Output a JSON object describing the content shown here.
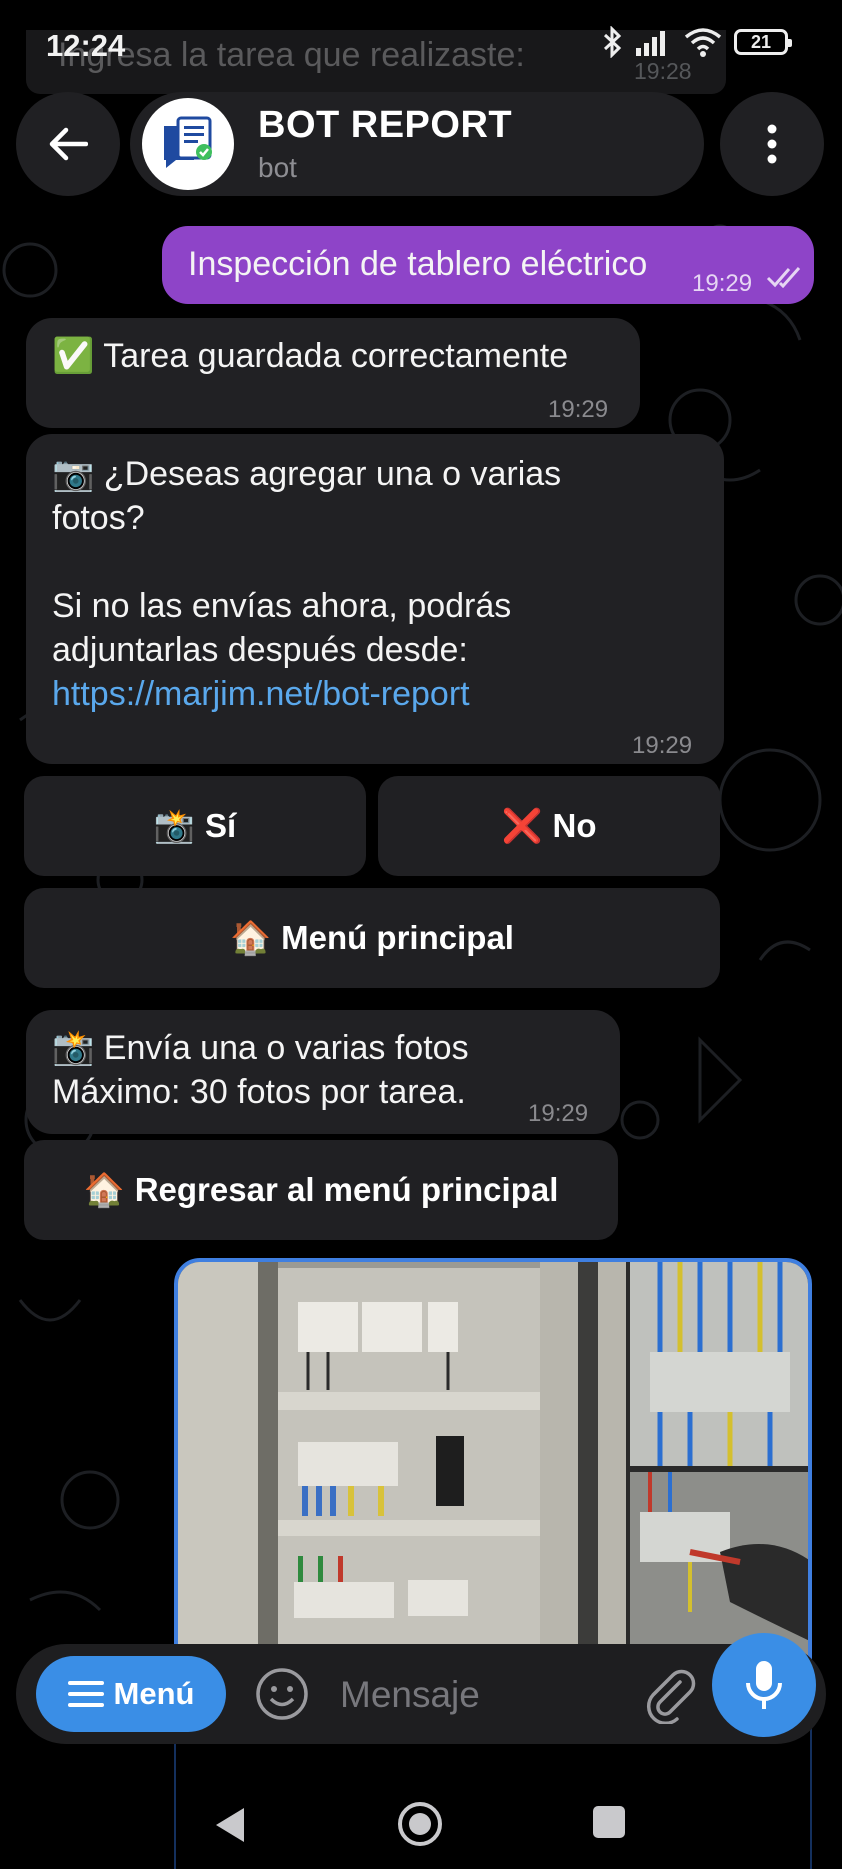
{
  "status_bar": {
    "time": "12:24",
    "battery": "21"
  },
  "ghost_message": {
    "text": "Ingresa la tarea que realizaste:",
    "time": "19:28"
  },
  "header": {
    "title": "BOT REPORT",
    "subtitle": "bot",
    "avatar_icon": "report-document-icon",
    "back_icon": "arrow-left-icon",
    "menu_icon": "more-vert-icon"
  },
  "messages": {
    "user_task": {
      "text": "Inspección de tablero eléctrico",
      "time": "19:29",
      "status_icon": "double-check-icon"
    },
    "saved": {
      "emoji": "✅",
      "text": "Tarea guardada correctamente",
      "time": "19:29"
    },
    "ask_photos": {
      "emoji": "📷",
      "line1": "¿Deseas agregar una o varias fotos?",
      "line2": "Si no las envías ahora, podrás adjuntarlas después desde:",
      "link": "https://marjim.net/bot-report",
      "time": "19:29"
    },
    "send_photos": {
      "emoji": "📸",
      "line1": "Envía una o varias fotos",
      "line2": "Máximo: 30 fotos por tarea.",
      "time": "19:29"
    }
  },
  "keyboard1": {
    "yes": {
      "emoji": "📸",
      "label": "Sí"
    },
    "no": {
      "emoji": "❌",
      "label": "No"
    },
    "main_menu": {
      "emoji": "🏠",
      "label": "Menú principal"
    }
  },
  "keyboard2": {
    "back_menu": {
      "emoji": "🏠",
      "label": "Regresar al menú principal"
    }
  },
  "input_bar": {
    "menu_label": "Menú",
    "placeholder": "Mensaje",
    "emoji_icon": "smile-icon",
    "attach_icon": "paperclip-icon",
    "mic_icon": "microphone-icon"
  },
  "colors": {
    "accent": "#3a8ee6",
    "outgoing": "#8e44c8",
    "bubble": "#212124",
    "link": "#5aa8ec"
  }
}
